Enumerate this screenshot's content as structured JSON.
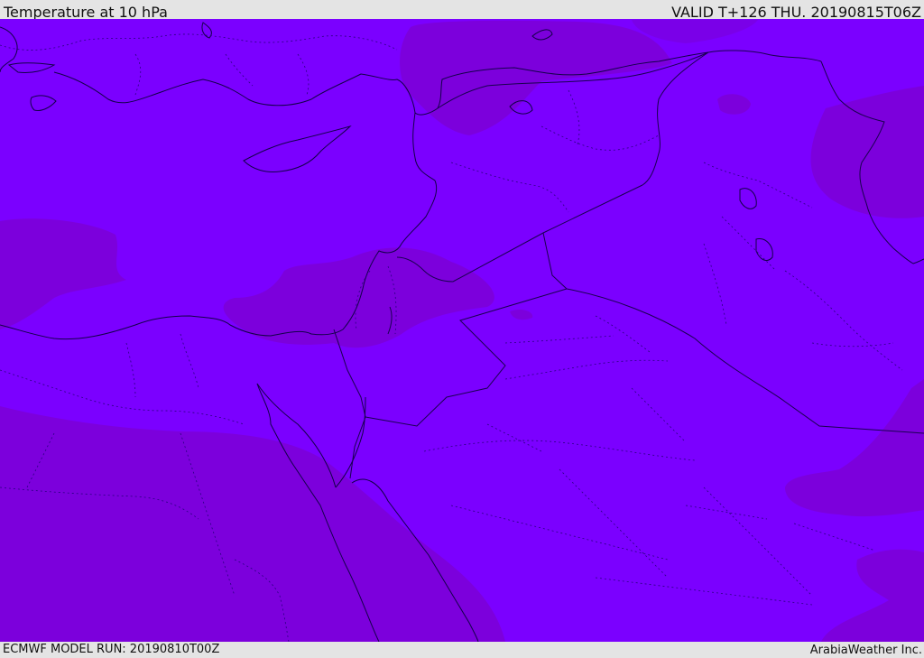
{
  "header": {
    "title": "Temperature at 10 hPa",
    "valid": "VALID T+126 THU. 20190815T06Z"
  },
  "footer": {
    "model_run": "ECMWF MODEL RUN: 20190810T00Z",
    "credit": "ArabiaWeather Inc."
  },
  "map": {
    "field": "temperature",
    "level": "10 hPa",
    "colors": {
      "base": "#7b00ff",
      "warm_patch": "#7c00dc",
      "coastline": "#14004a",
      "border": "#1a0050"
    }
  }
}
